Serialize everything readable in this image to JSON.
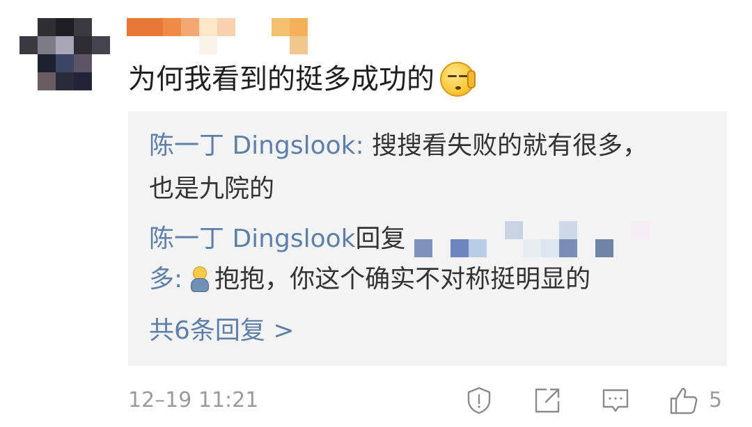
{
  "comment": {
    "text": "为何我看到的挺多成功的",
    "emoji": "smirk-hand-emoji"
  },
  "replies": {
    "reply1": {
      "author": "陈一丁 Dingslook",
      "separator": ":",
      "text_line1": " 搜搜看失败的就有很多，",
      "text_line2": "也是九院的"
    },
    "reply2": {
      "author": "陈一丁 Dingslook",
      "reply_word": "回复",
      "target_suffix": "多",
      "separator": ":",
      "emoji": "hug-emoji",
      "text": "抱抱，你这个确实不对称挺明显的"
    },
    "more_replies": "共6条回复 >"
  },
  "footer": {
    "timestamp": "12–19 11:21",
    "like_count": "5",
    "icons": [
      "report-icon",
      "share-icon",
      "comment-icon",
      "like-icon"
    ]
  },
  "colors": {
    "link_blue": "#5d7fa8",
    "reply_bg": "#f3f3f3",
    "meta_gray": "#9b9b9b"
  }
}
